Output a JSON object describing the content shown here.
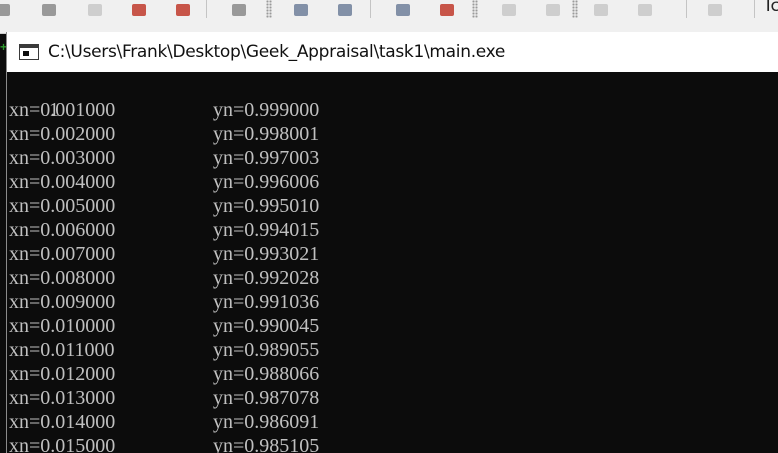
{
  "background_toolbar": {
    "buttons": [
      "save-icon",
      "save-all-icon",
      "compile-icon",
      "run-icon",
      "print-icon",
      "find-icon",
      "find-in-files-icon",
      "bookmark-icon",
      "step-icon",
      "undo-icon",
      "redo-icon",
      "copy-icon",
      "paste-icon",
      "stop-icon"
    ],
    "edge_text": "Tc"
  },
  "window": {
    "title": "C:\\Users\\Frank\\Desktop\\Geek_Appraisal\\task1\\main.exe"
  },
  "console": {
    "first_line": "1",
    "rows": [
      {
        "x": "xn=0.001000",
        "y": "yn=0.999000"
      },
      {
        "x": "xn=0.002000",
        "y": "yn=0.998001"
      },
      {
        "x": "xn=0.003000",
        "y": "yn=0.997003"
      },
      {
        "x": "xn=0.004000",
        "y": "yn=0.996006"
      },
      {
        "x": "xn=0.005000",
        "y": "yn=0.995010"
      },
      {
        "x": "xn=0.006000",
        "y": "yn=0.994015"
      },
      {
        "x": "xn=0.007000",
        "y": "yn=0.993021"
      },
      {
        "x": "xn=0.008000",
        "y": "yn=0.992028"
      },
      {
        "x": "xn=0.009000",
        "y": "yn=0.991036"
      },
      {
        "x": "xn=0.010000",
        "y": "yn=0.990045"
      },
      {
        "x": "xn=0.011000",
        "y": "yn=0.989055"
      },
      {
        "x": "xn=0.012000",
        "y": "yn=0.988066"
      },
      {
        "x": "xn=0.013000",
        "y": "yn=0.987078"
      },
      {
        "x": "xn=0.014000",
        "y": "yn=0.986091"
      },
      {
        "x": "xn=0.015000",
        "y": "yn=0.985105"
      }
    ]
  },
  "colors": {
    "console_background": "#0c0c0c",
    "console_text": "#c0c0c0",
    "title_bar": "#ffffff"
  }
}
